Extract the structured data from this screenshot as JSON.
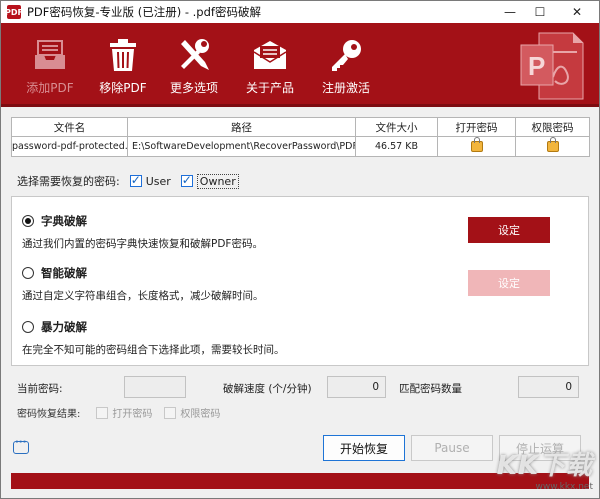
{
  "window": {
    "title": "PDF密码恢复-专业版 (已注册) - .pdf密码破解",
    "app_icon": "PDF",
    "controls": {
      "minimize": "—",
      "maximize": "☐",
      "close": "✕"
    }
  },
  "toolbar": {
    "items": [
      {
        "label": "添加PDF",
        "icon": "inbox-icon",
        "enabled": false
      },
      {
        "label": "移除PDF",
        "icon": "trash-icon",
        "enabled": true
      },
      {
        "label": "更多选项",
        "icon": "tools-icon",
        "enabled": true
      },
      {
        "label": "关于产品",
        "icon": "envelope-icon",
        "enabled": true
      },
      {
        "label": "注册激活",
        "icon": "key-icon",
        "enabled": true
      }
    ],
    "colors": {
      "background": "#a31117",
      "disabled_text": "#d98d92"
    }
  },
  "file_table": {
    "headers": [
      "文件名",
      "路径",
      "文件大小",
      "打开密码",
      "权限密码"
    ],
    "rows": [
      {
        "name": "password-pdf-protected.pd",
        "path": "E:\\SoftwareDevelopment\\RecoverPassword\\PDF Pass",
        "size": "46.57 KB",
        "open_password": "lock-icon",
        "permission_password": "lock-icon"
      }
    ]
  },
  "password_select": {
    "label": "选择需要恢复的密码:",
    "user_label": "User",
    "user_checked": true,
    "owner_label": "Owner",
    "owner_checked": true
  },
  "modes": [
    {
      "title": "字典破解",
      "desc": "通过我们内置的密码字典快速恢复和破解PDF密码。",
      "selected": true,
      "button": "设定",
      "button_enabled": true
    },
    {
      "title": "智能破解",
      "desc": "通过自定义字符串组合，长度格式，减少破解时间。",
      "selected": false,
      "button": "设定",
      "button_enabled": false
    },
    {
      "title": "暴力破解",
      "desc": "在完全不知可能的密码组合下选择此项，需要较长时间。",
      "selected": false,
      "button": null,
      "button_enabled": false
    }
  ],
  "status": {
    "current_password_label": "当前密码:",
    "current_password_value": "",
    "speed_label": "破解速度 (个/分钟)",
    "speed_value": "0",
    "match_count_label": "匹配密码数量",
    "match_count_value": "0"
  },
  "result": {
    "label": "密码恢复结果:",
    "open_label": "打开密码",
    "permission_label": "权限密码"
  },
  "actions": {
    "start": "开始恢复",
    "pause": "Pause",
    "stop": "停止运算"
  },
  "watermark": {
    "main": "KK下载",
    "sub": "www.kkx.net"
  }
}
